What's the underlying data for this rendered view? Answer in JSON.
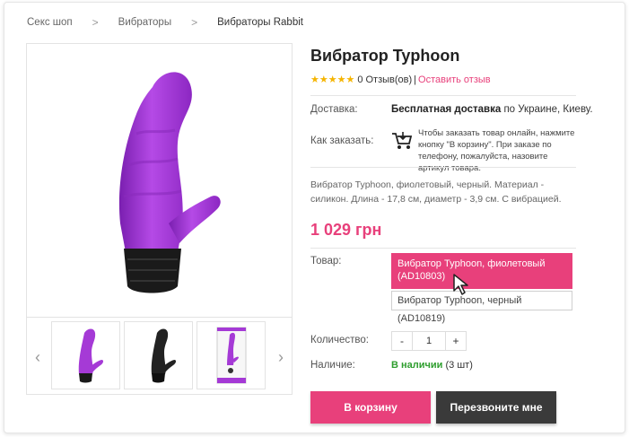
{
  "breadcrumb": {
    "items": [
      "Секс шоп",
      "Вибраторы",
      "Вибраторы Rabbit"
    ],
    "separator": ">"
  },
  "product": {
    "title": "Вибратор Typhoon",
    "rating_stars": "★★★★★",
    "reviews_label": "0 Отзыв(ов)",
    "pipe": "|",
    "leave_review": "Оставить отзыв",
    "delivery_label": "Доставка:",
    "delivery_bold": "Бесплатная доставка",
    "delivery_rest": " по Украине, Киеву.",
    "how_to_order_label": "Как заказать:",
    "how_to_order_text": "Чтобы заказать товар онлайн, нажмите кнопку \"В корзину\". При заказе по телефону, пожалуйста, назовите артикул товара.",
    "description": "Вибратор Typhoon, фиолетовый, черный. Материал - силикон. Длина - 17,8 см, диаметр - 3,9 см. С вибрацией.",
    "price": "1 029 грн",
    "variant_label": "Товар:",
    "variants": [
      "Вибратор Typhoon, фиолетовый (AD10803)",
      "Вибратор Typhoon, черный (AD10819)"
    ],
    "quantity_label": "Количество:",
    "quantity_minus": "-",
    "quantity_value": "1",
    "quantity_plus": "+",
    "availability_label": "Наличие:",
    "availability_status": "В наличии",
    "availability_count": " (3 шт)",
    "add_to_cart": "В корзину",
    "call_me": "Перезвоните мне"
  },
  "gallery": {
    "prev_arrow": "‹",
    "next_arrow": "›",
    "thumbnails": [
      "purple-vibrator",
      "black-vibrator",
      "boxed-vibrator"
    ]
  },
  "colors": {
    "accent": "#e8407b",
    "purple": "#a53ad6",
    "dark": "#3a3a3a",
    "in_stock": "#2e9e2e"
  }
}
